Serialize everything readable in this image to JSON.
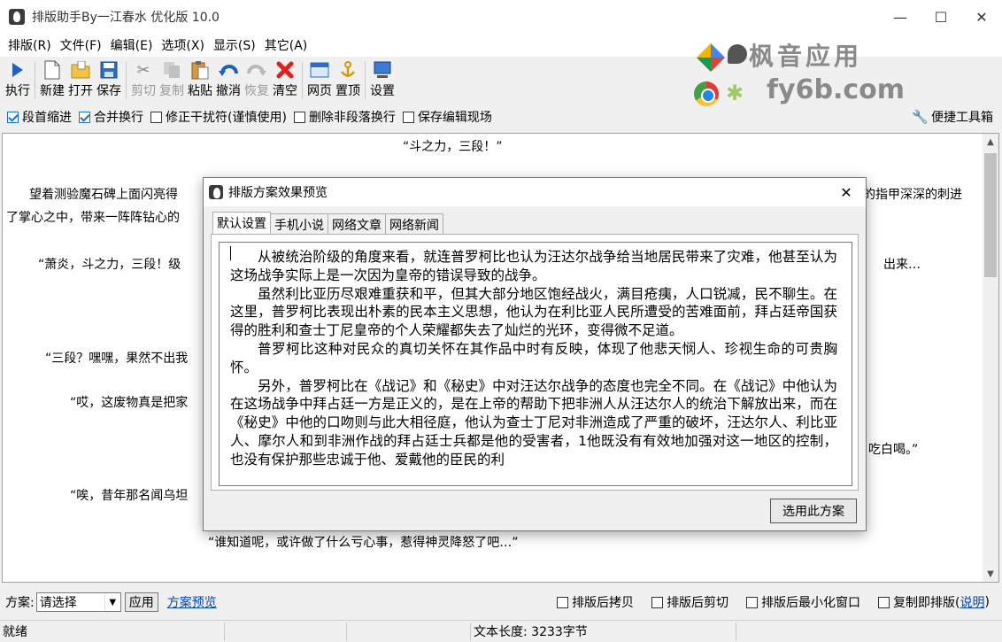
{
  "window": {
    "title": "排版助手By一江春水 优化版 10.0",
    "minimize": "—",
    "maximize": "☐",
    "close": "✕"
  },
  "menu": [
    "排版(R)",
    "文件(F)",
    "编辑(E)",
    "选项(X)",
    "显示(S)",
    "其它(A)"
  ],
  "watermark": {
    "line1": "枫音应用",
    "line2": "fy6b.com"
  },
  "toolbar": {
    "run": "执行",
    "new": "新建",
    "open": "打开",
    "save": "保存",
    "cut": "剪切",
    "copy": "复制",
    "paste": "粘贴",
    "undo": "撤消",
    "redo": "恢复",
    "clear": "清空",
    "webpage": "网页",
    "top": "置顶",
    "settings": "设置"
  },
  "options": {
    "indent": "段首缩进",
    "merge": "合并换行",
    "fix_interference": "修正干扰符(谨慎使用)",
    "delete_non_para": "删除非段落换行",
    "save_scene": "保存编辑现场",
    "quick_tools": "便捷工具箱"
  },
  "editor": {
    "line1": "“斗之力，三段！”",
    "line2a": "望着测验魔石碑上面闪亮得",
    "line2b": "的指甲深深的刺进",
    "line3": "了掌心之中，带来一阵阵钻心的",
    "line4a": "“萧炎，斗之力，三段！级",
    "line4b": "出来…",
    "line5": "“三段？嘿嘿，果然不出我",
    "line6": "“哎，这废物真是把家",
    "line6b": "吃白喝。”",
    "line7": "“唉，昔年那名闻乌坦",
    "line8": "“谁知道呢，或许做了什么亏心事，惹得神灵降怒了吧…”"
  },
  "dialog": {
    "title": "排版方案效果预览",
    "close": "✕",
    "tabs": [
      "默认设置",
      "手机小说",
      "网络文章",
      "网络新闻"
    ],
    "paragraphs": [
      "从被统治阶级的角度来看，就连普罗柯比也认为汪达尔战争给当地居民带来了灾难，他甚至认为这场战争实际上是一次因为皇帝的错误导致的战争。",
      "虽然利比亚历尽艰难重获和平，但其大部分地区饱经战火，满目疮痍，人口锐减，民不聊生。在这里，普罗柯比表现出朴素的民本主义思想，他认为在利比亚人民所遭受的苦难面前，拜占廷帝国获得的胜利和查士丁尼皇帝的个人荣耀都失去了灿烂的光环，变得微不足道。",
      "普罗柯比这种对民众的真切关怀在其作品中时有反映，体现了他悲天悯人、珍视生命的可贵胸怀。",
      "另外，普罗柯比在《战记》和《秘史》中对汪达尔战争的态度也完全不同。在《战记》中他认为在这场战争中拜占廷一方是正义的，是在上帝的帮助下把非洲人从汪达尔人的统治下解放出来，而在《秘史》中他的口吻则与此大相径庭，他认为查士丁尼对非洲造成了严重的破坏，汪达尔人、利比亚人、摩尔人和到非洲作战的拜占廷士兵都是他的受害者，1他既没有有效地加强对这一地区的控制，也没有保护那些忠诚于他、爱戴他的臣民的利"
    ],
    "use_button": "选用此方案"
  },
  "bottom": {
    "scheme_label": "方案:",
    "scheme_value": "请选择",
    "apply": "应用",
    "preview_link": "方案预览",
    "copy_after": "排版后拷贝",
    "cut_after": "排版后剪切",
    "minimize_after": "排版后最小化窗口",
    "copy_instant": "复制即排版(",
    "help_link": "说明",
    "close_paren": ")"
  },
  "status": {
    "ready": "就绪",
    "length": "文本长度: 3233字节"
  },
  "colors": {
    "link": "#0645ad",
    "check_accent": "#1c6fd1"
  }
}
